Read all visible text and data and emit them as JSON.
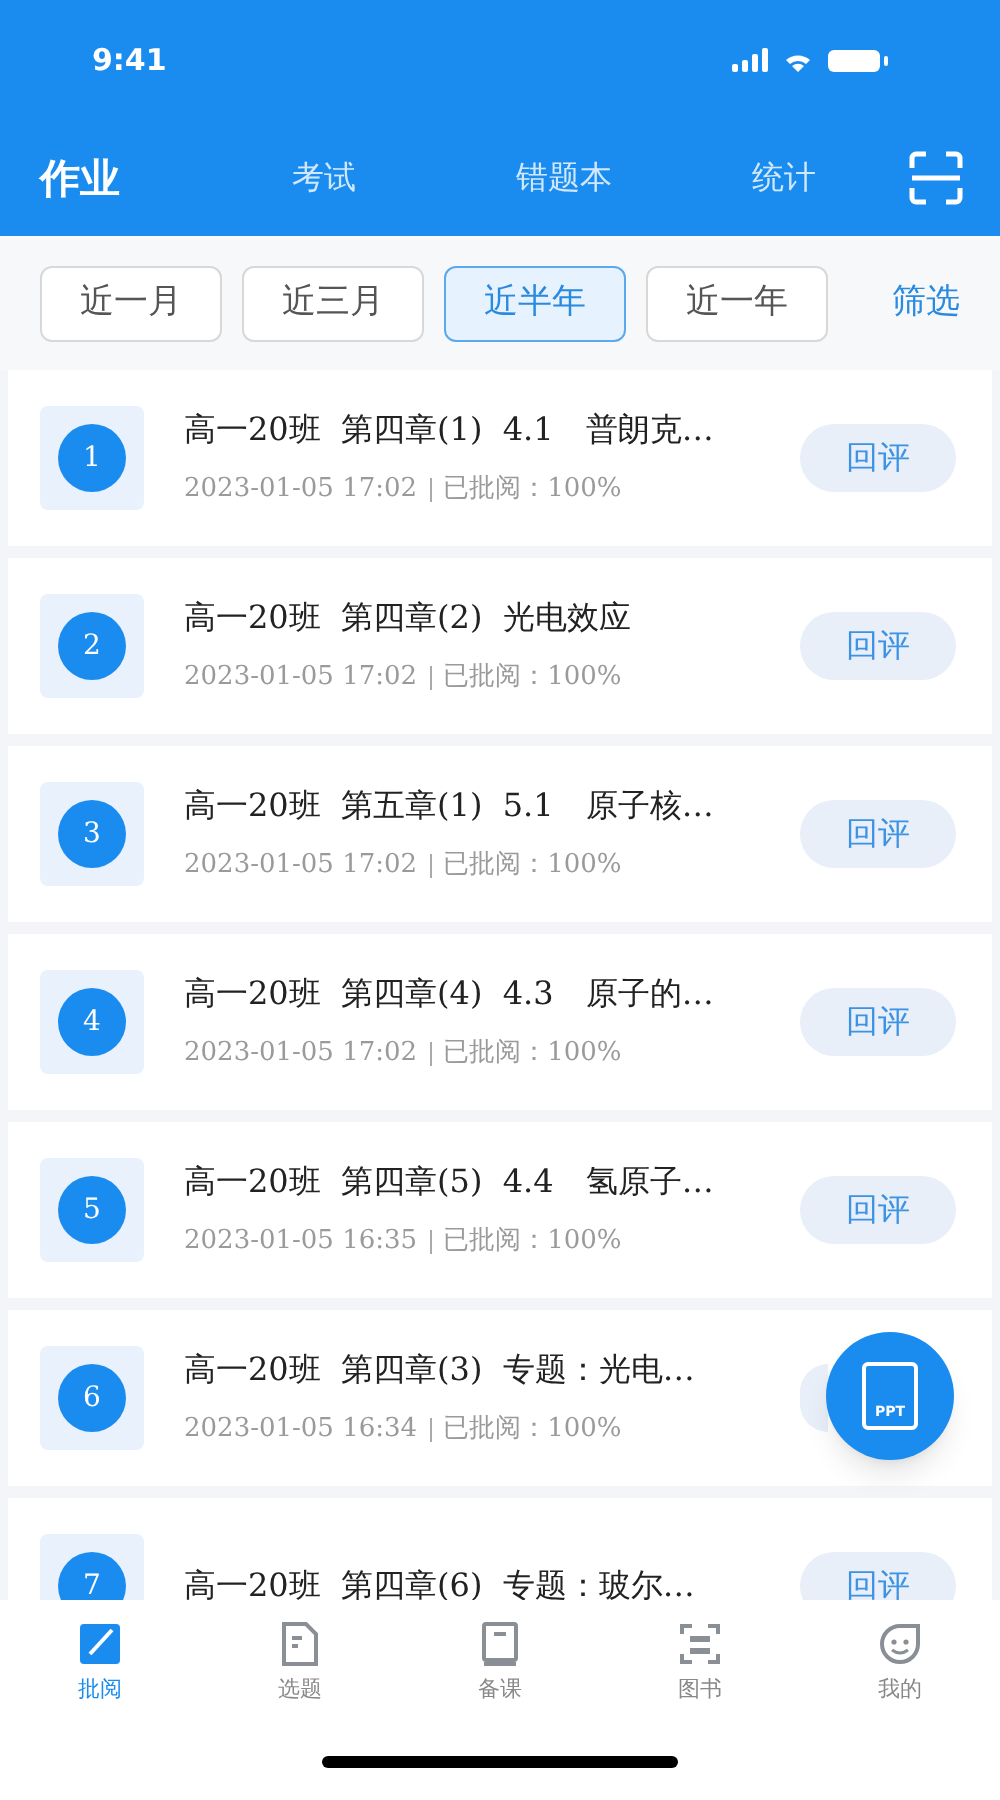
{
  "status_bar": {
    "time": "9:41"
  },
  "top_tabs": [
    {
      "label": "作业",
      "selected": true
    },
    {
      "label": "考试",
      "selected": false
    },
    {
      "label": "错题本",
      "selected": false
    },
    {
      "label": "统计",
      "selected": false
    }
  ],
  "filters": [
    {
      "label": "近一月",
      "selected": false
    },
    {
      "label": "近三月",
      "selected": false
    },
    {
      "label": "近半年",
      "selected": true
    },
    {
      "label": "近一年",
      "selected": false
    }
  ],
  "filter_link": "筛选",
  "items": [
    {
      "number": "1",
      "title": "高一20班  第四章(1)  4.1　普朗克…",
      "time": "2023-01-05 17:02",
      "status": "已批阅：100%",
      "action": "回评"
    },
    {
      "number": "2",
      "title": "高一20班  第四章(2)  光电效应",
      "time": "2023-01-05 17:02",
      "status": "已批阅：100%",
      "action": "回评"
    },
    {
      "number": "3",
      "title": "高一20班  第五章(1)  5.1　原子核…",
      "time": "2023-01-05 17:02",
      "status": "已批阅：100%",
      "action": "回评"
    },
    {
      "number": "4",
      "title": "高一20班  第四章(4)  4.3　原子的…",
      "time": "2023-01-05 17:02",
      "status": "已批阅：100%",
      "action": "回评"
    },
    {
      "number": "5",
      "title": "高一20班  第四章(5)  4.4　氢原子…",
      "time": "2023-01-05 16:35",
      "status": "已批阅：100%",
      "action": "回评"
    },
    {
      "number": "6",
      "title": "高一20班  第四章(3)  专题：光电…",
      "time": "2023-01-05 16:34",
      "status": "已批阅：100%"
    },
    {
      "number": "7",
      "title": "高一20班  第四章(6)  专题：玻尔…",
      "action": "回评"
    }
  ],
  "fab": {
    "label": "PPT"
  },
  "bottom_tabs": [
    {
      "label": "批阅",
      "selected": true,
      "kind": "edit"
    },
    {
      "label": "选题",
      "selected": false,
      "kind": "doc"
    },
    {
      "label": "备课",
      "selected": false,
      "kind": "book"
    },
    {
      "label": "图书",
      "selected": false,
      "kind": "scan"
    },
    {
      "label": "我的",
      "selected": false,
      "kind": "face"
    }
  ]
}
